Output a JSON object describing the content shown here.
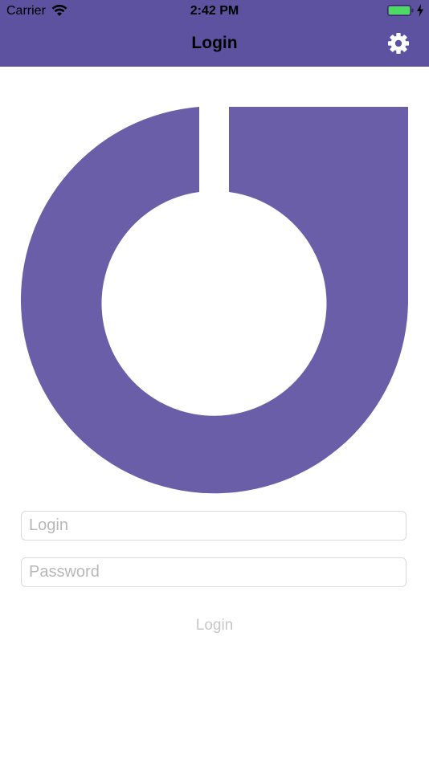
{
  "status_bar": {
    "carrier": "Carrier",
    "time": "2:42 PM",
    "wifi_icon": "wifi-icon",
    "battery_icon": "battery-icon",
    "charging_icon": "charging-bolt-icon"
  },
  "nav": {
    "title": "Login",
    "settings_icon": "gear-icon"
  },
  "logo": {
    "icon": "brand-logo",
    "color": "#6a5ea8"
  },
  "form": {
    "login_placeholder": "Login",
    "login_value": "",
    "password_placeholder": "Password",
    "password_value": "",
    "submit_label": "Login"
  },
  "colors": {
    "header": "#5c52a0",
    "brand": "#6a5ea8",
    "battery": "#4cd964",
    "disabled_text": "#c7c7c7"
  }
}
